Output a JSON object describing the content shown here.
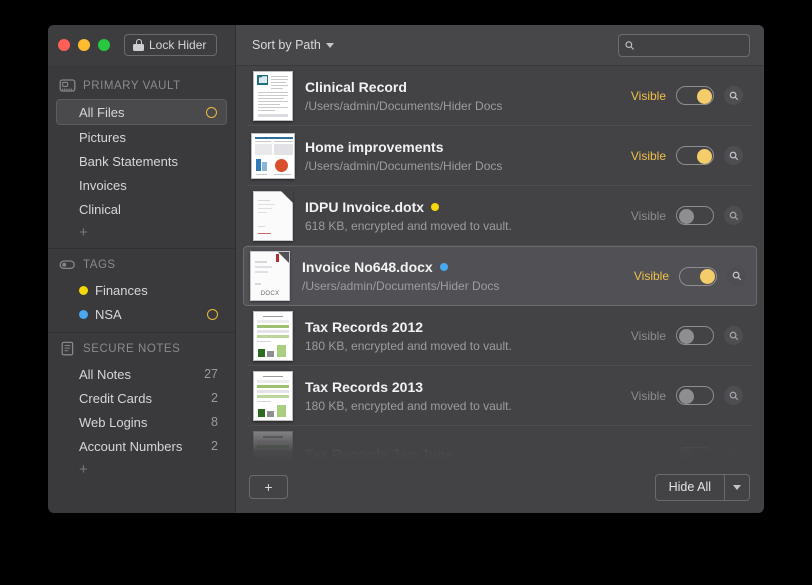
{
  "window": {
    "lock_button_label": "Lock Hider",
    "traffic_lights": [
      "close",
      "minimize",
      "zoom"
    ]
  },
  "sidebar": {
    "sections": [
      {
        "id": "primary-vault",
        "title": "PRIMARY VAULT",
        "icon": "vault-drive-icon",
        "items": [
          {
            "label": "All Files",
            "selected": true,
            "ring": true
          },
          {
            "label": "Pictures",
            "selected": false,
            "ring": false
          },
          {
            "label": "Bank Statements",
            "selected": false,
            "ring": false
          },
          {
            "label": "Invoices",
            "selected": false,
            "ring": false
          },
          {
            "label": "Clinical",
            "selected": false,
            "ring": false
          }
        ],
        "add_label": "+"
      },
      {
        "id": "tags",
        "title": "TAGS",
        "icon": "tag-toggle-icon",
        "items": [
          {
            "label": "Finances",
            "dot": "#f5d80a",
            "ring": false
          },
          {
            "label": "NSA",
            "dot": "#4aa8f0",
            "ring": true
          }
        ]
      },
      {
        "id": "secure-notes",
        "title": "SECURE NOTES",
        "icon": "note-page-icon",
        "items": [
          {
            "label": "All Notes",
            "count": "27"
          },
          {
            "label": "Credit Cards",
            "count": "2"
          },
          {
            "label": "Web Logins",
            "count": "8"
          },
          {
            "label": "Account Numbers",
            "count": "2"
          }
        ],
        "add_label": "+"
      }
    ]
  },
  "toolbar": {
    "sort_label": "Sort by Path",
    "search_placeholder": ""
  },
  "files": [
    {
      "title": "Clinical Record",
      "subtitle": "/Users/admin/Documents/Hider Docs",
      "visible_label": "Visible",
      "visible": true,
      "tag_dot": null,
      "thumb": "text-document",
      "selected": false,
      "faded": false
    },
    {
      "title": "Home improvements",
      "subtitle": "/Users/admin/Documents/Hider Docs",
      "visible_label": "Visible",
      "visible": true,
      "tag_dot": null,
      "thumb": "chart-document",
      "selected": false,
      "faded": false
    },
    {
      "title": "IDPU Invoice.dotx",
      "subtitle": "618 KB, encrypted and moved to vault.",
      "visible_label": "Visible",
      "visible": false,
      "tag_dot": "#f5d80a",
      "thumb": "blank-page",
      "selected": false,
      "faded": false
    },
    {
      "title": "Invoice No648.docx",
      "subtitle": "/Users/admin/Documents/Hider Docs",
      "visible_label": "Visible",
      "visible": true,
      "tag_dot": "#4aa8f0",
      "thumb": "docx-page",
      "selected": true,
      "faded": false
    },
    {
      "title": "Tax Records 2012",
      "subtitle": "180 KB, encrypted and moved to vault.",
      "visible_label": "Visible",
      "visible": false,
      "tag_dot": null,
      "thumb": "spreadsheet-green",
      "selected": false,
      "faded": false
    },
    {
      "title": "Tax Records 2013",
      "subtitle": "180 KB, encrypted and moved to vault.",
      "visible_label": "Visible",
      "visible": false,
      "tag_dot": null,
      "thumb": "spreadsheet-green",
      "selected": false,
      "faded": false
    },
    {
      "title": "Tax Records Jan-June",
      "subtitle": "",
      "visible_label": "Visible",
      "visible": false,
      "tag_dot": null,
      "thumb": "spreadsheet-green",
      "selected": false,
      "faded": true
    }
  ],
  "bottom_bar": {
    "add_label": "+",
    "hide_all_label": "Hide All"
  },
  "colors": {
    "accent_yellow": "#f4cc6a",
    "tag_yellow": "#f5d80a",
    "tag_blue": "#4aa8f0",
    "window_bg": "#434346",
    "sidebar_bg": "#3a3a3c"
  }
}
